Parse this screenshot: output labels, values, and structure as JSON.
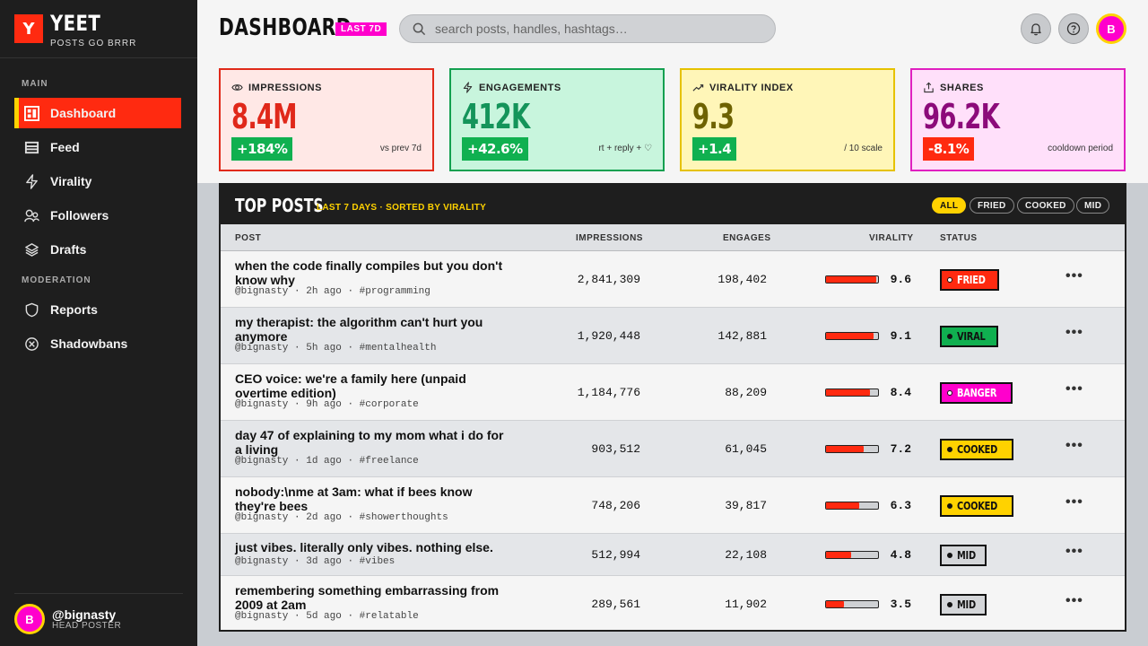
{
  "brand": {
    "logo_letter": "Y",
    "name": "YEET",
    "tagline": "POSTS GO BRRR"
  },
  "sidebar": {
    "sections": [
      {
        "title": "MAIN",
        "items": [
          {
            "label": "Dashboard",
            "icon": "dashboard-icon",
            "active": true
          },
          {
            "label": "Feed",
            "icon": "feed-icon"
          },
          {
            "label": "Virality",
            "icon": "bolt-icon"
          },
          {
            "label": "Followers",
            "icon": "followers-icon"
          },
          {
            "label": "Drafts",
            "icon": "layers-icon"
          }
        ]
      },
      {
        "title": "MODERATION",
        "items": [
          {
            "label": "Reports",
            "icon": "shield-icon"
          },
          {
            "label": "Shadowbans",
            "icon": "x-circle-icon"
          }
        ]
      }
    ],
    "user": {
      "initial": "B",
      "handle": "@bignasty",
      "role": "HEAD POSTER"
    }
  },
  "header": {
    "title": "DASHBOARD",
    "range_badge": "LAST 7D",
    "search_placeholder": "search posts, handles, hashtags…",
    "avatar_initial": "B"
  },
  "stats": [
    {
      "label": "IMPRESSIONS",
      "icon": "eye-icon",
      "value": "8.4M",
      "delta": "+184%",
      "delta_color": "#10b050",
      "note": "vs prev 7d",
      "bg": "#ffe8e6",
      "border": "#e02a1a",
      "value_color": "#e0281a"
    },
    {
      "label": "ENGAGEMENTS",
      "icon": "bolt-icon",
      "value": "412K",
      "delta": "+42.6%",
      "delta_color": "#10b050",
      "note": "rt + reply + ♡",
      "bg": "#c8f5dd",
      "border": "#14a050",
      "value_color": "#14945a"
    },
    {
      "label": "VIRALITY INDEX",
      "icon": "trend-icon",
      "value": "9.3",
      "delta": "+1.4",
      "delta_color": "#10b050",
      "note": "/ 10 scale",
      "bg": "#fff6b8",
      "border": "#e6c200",
      "value_color": "#6e6200"
    },
    {
      "label": "SHARES",
      "icon": "share-icon",
      "value": "96.2K",
      "delta": "-8.1%",
      "delta_color": "#ff2a10",
      "note": "cooldown period",
      "bg": "#ffe0fa",
      "border": "#e020c0",
      "value_color": "#8c0a7a"
    }
  ],
  "table": {
    "title": "TOP POSTS",
    "subtitle": "LAST 7 DAYS · SORTED BY VIRALITY",
    "filters": [
      "ALL",
      "FRIED",
      "COOKED",
      "MID"
    ],
    "active_filter": "ALL",
    "columns": [
      "POST",
      "IMPRESSIONS",
      "ENGAGES",
      "VIRALITY",
      "STATUS"
    ],
    "rows": [
      {
        "title": "when the code finally compiles but you don't know why",
        "handle": "@bignasty",
        "time": "2h ago",
        "tag": "#programming",
        "impressions": "2,841,309",
        "engages": "198,402",
        "virality": 9.6,
        "virality_label": "9.6",
        "status": "FRIED",
        "status_color": "#ff2a10",
        "status_text_color": "#ffffff"
      },
      {
        "title": "my therapist: the algorithm can't hurt you anymore",
        "handle": "@bignasty",
        "time": "5h ago",
        "tag": "#mentalhealth",
        "impressions": "1,920,448",
        "engages": "142,881",
        "virality": 9.1,
        "virality_label": "9.1",
        "status": "VIRAL",
        "status_color": "#10b050",
        "status_text_color": "#111111"
      },
      {
        "title": "CEO voice: we're a family here (unpaid overtime edition)",
        "handle": "@bignasty",
        "time": "9h ago",
        "tag": "#corporate",
        "impressions": "1,184,776",
        "engages": "88,209",
        "virality": 8.4,
        "virality_label": "8.4",
        "status": "BANGER",
        "status_color": "#ff00cc",
        "status_text_color": "#ffffff"
      },
      {
        "title": "day 47 of explaining to my mom what i do for a living",
        "handle": "@bignasty",
        "time": "1d ago",
        "tag": "#freelance",
        "impressions": "903,512",
        "engages": "61,045",
        "virality": 7.2,
        "virality_label": "7.2",
        "status": "COOKED",
        "status_color": "#ffd200",
        "status_text_color": "#111111"
      },
      {
        "title": "nobody:\\nme at 3am: what if bees know they're bees",
        "handle": "@bignasty",
        "time": "2d ago",
        "tag": "#showerthoughts",
        "impressions": "748,206",
        "engages": "39,817",
        "virality": 6.3,
        "virality_label": "6.3",
        "status": "COOKED",
        "status_color": "#ffd200",
        "status_text_color": "#111111"
      },
      {
        "title": "just vibes. literally only vibes. nothing else.",
        "handle": "@bignasty",
        "time": "3d ago",
        "tag": "#vibes",
        "impressions": "512,994",
        "engages": "22,108",
        "virality": 4.8,
        "virality_label": "4.8",
        "status": "MID",
        "status_color": "#d4d6d9",
        "status_text_color": "#111111"
      },
      {
        "title": "remembering something embarrassing from 2009 at 2am",
        "handle": "@bignasty",
        "time": "5d ago",
        "tag": "#relatable",
        "impressions": "289,561",
        "engages": "11,902",
        "virality": 3.5,
        "virality_label": "3.5",
        "status": "MID",
        "status_color": "#d4d6d9",
        "status_text_color": "#111111"
      }
    ]
  }
}
